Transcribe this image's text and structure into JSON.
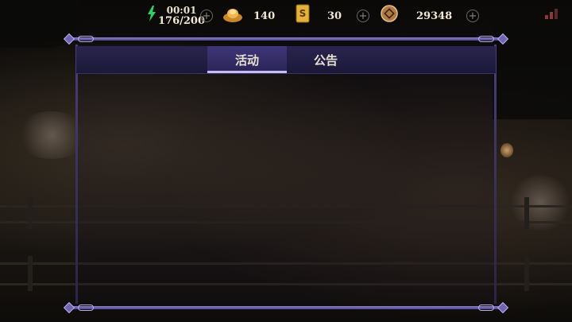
{
  "resources": {
    "energy": {
      "timer": "00:01",
      "value": "176/200",
      "icon": "lightning-icon",
      "color": "#2fd06a"
    },
    "ingot": {
      "value": "140",
      "icon": "gold-ingot-icon",
      "color": "#e0a23a"
    },
    "ticket": {
      "value": "30",
      "icon": "ticket-icon",
      "color": "#e3b13c"
    },
    "coin": {
      "value": "29348",
      "icon": "coin-icon",
      "color": "#b07a46"
    },
    "plus_symbol": "+"
  },
  "panel": {
    "tabs": [
      {
        "label": "活动",
        "active": true
      },
      {
        "label": "公告",
        "active": false
      }
    ],
    "accent_color": "#8a7fc8"
  },
  "status": {
    "signal_icon": "signal-icon"
  }
}
